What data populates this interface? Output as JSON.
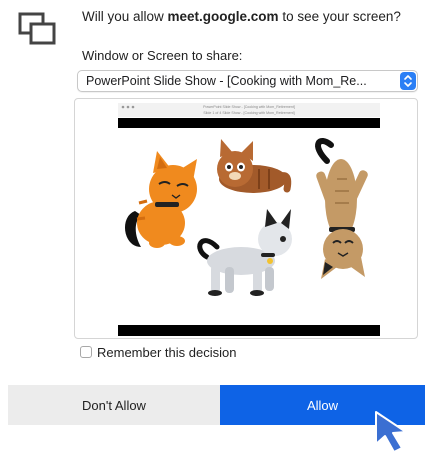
{
  "dialog": {
    "prompt_prefix": "Will you allow ",
    "site": "meet.google.com",
    "prompt_suffix": " to see your screen?",
    "source_label": "Window or Screen to share:",
    "selected_source": "PowerPoint Slide Show - [Cooking with Mom_Re...",
    "remember_label": "Remember this decision",
    "remember_checked": false
  },
  "buttons": {
    "deny": "Don't Allow",
    "allow": "Allow"
  },
  "preview": {
    "title_line1": "PowerPoint Slide Show - [Cooking with Mom_Retirement]",
    "title_line2": "Slide 1 of 4 Slide Show - [Cooking with Mom_Retirement]"
  },
  "colors": {
    "accent": "#0e63e6",
    "select_arrow": "#2b7ff5",
    "deny_button_bg": "#ececec",
    "cat_orange": "#f08a1e",
    "cat_brown": "#a25a2a",
    "cat_tan": "#c49a66",
    "cat_grey": "#d7dadf"
  },
  "icons": {
    "app": "screen-share-icon",
    "select": "chevron-updown-icon",
    "cursor": "mouse-pointer-icon"
  }
}
